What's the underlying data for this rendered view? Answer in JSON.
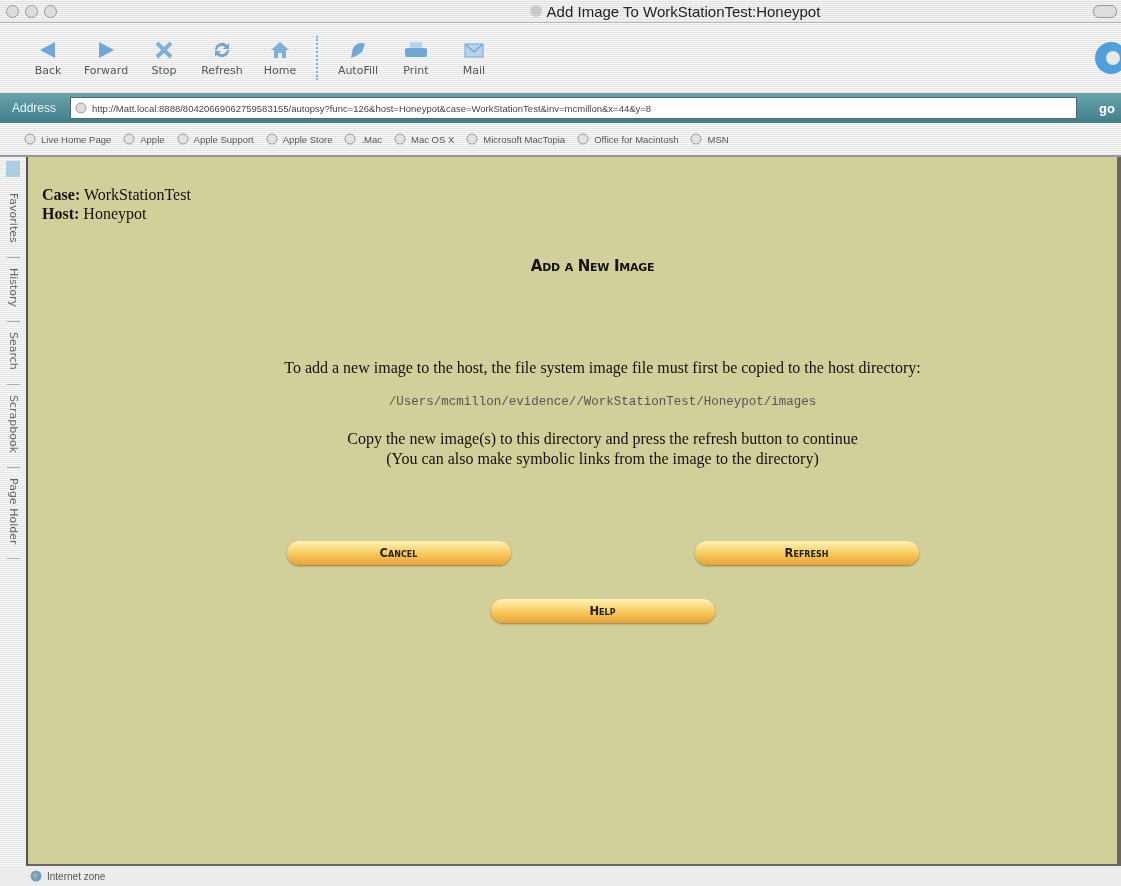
{
  "window": {
    "title": "Add Image To WorkStationTest:Honeypot"
  },
  "toolbar": {
    "navigation": [
      {
        "label": "Back",
        "kind": "back"
      },
      {
        "label": "Forward",
        "kind": "forward"
      },
      {
        "label": "Stop",
        "kind": "stop"
      },
      {
        "label": "Refresh",
        "kind": "refresh"
      },
      {
        "label": "Home",
        "kind": "home"
      }
    ],
    "tools": [
      {
        "label": "AutoFill",
        "kind": "autofill"
      },
      {
        "label": "Print",
        "kind": "print"
      },
      {
        "label": "Mail",
        "kind": "mail"
      }
    ]
  },
  "address": {
    "label": "Address",
    "url": "http://Matt.local:8888/80420669062759583155/autopsy?func=126&host=Honeypot&case=WorkStationTest&inv=mcmillon&x=44&y=8",
    "go": "go"
  },
  "favorites": [
    "Live Home Page",
    "Apple",
    "Apple Support",
    "Apple Store",
    ".Mac",
    "Mac OS X",
    "Microsoft MacTopia",
    "Office for Macintosh",
    "MSN"
  ],
  "sidebar_tabs": [
    "Favorites",
    "History",
    "Search",
    "Scrapbook",
    "Page Holder"
  ],
  "content": {
    "case_line": "**Case:** WorkStationTest",
    "host_line": "**Host:** Honeypot",
    "heading": "Add a New Image",
    "instruction": "To add a new image to the host, the file system image file must first be copied to the host directory:",
    "path": "/Users/mcmillon/evidence//WorkStationTest/Honeypot/images",
    "note_lines": [
      "Copy the new image(s) to this directory and press the refresh button to continue",
      "(You can also make symbolic links from the image to the directory)"
    ],
    "button_rows": [
      [
        {
          "label": "Cancel"
        },
        {
          "label": "Refresh"
        }
      ],
      [
        {
          "label": "Help"
        }
      ]
    ]
  },
  "status_bar": {
    "zone": "Internet zone"
  }
}
